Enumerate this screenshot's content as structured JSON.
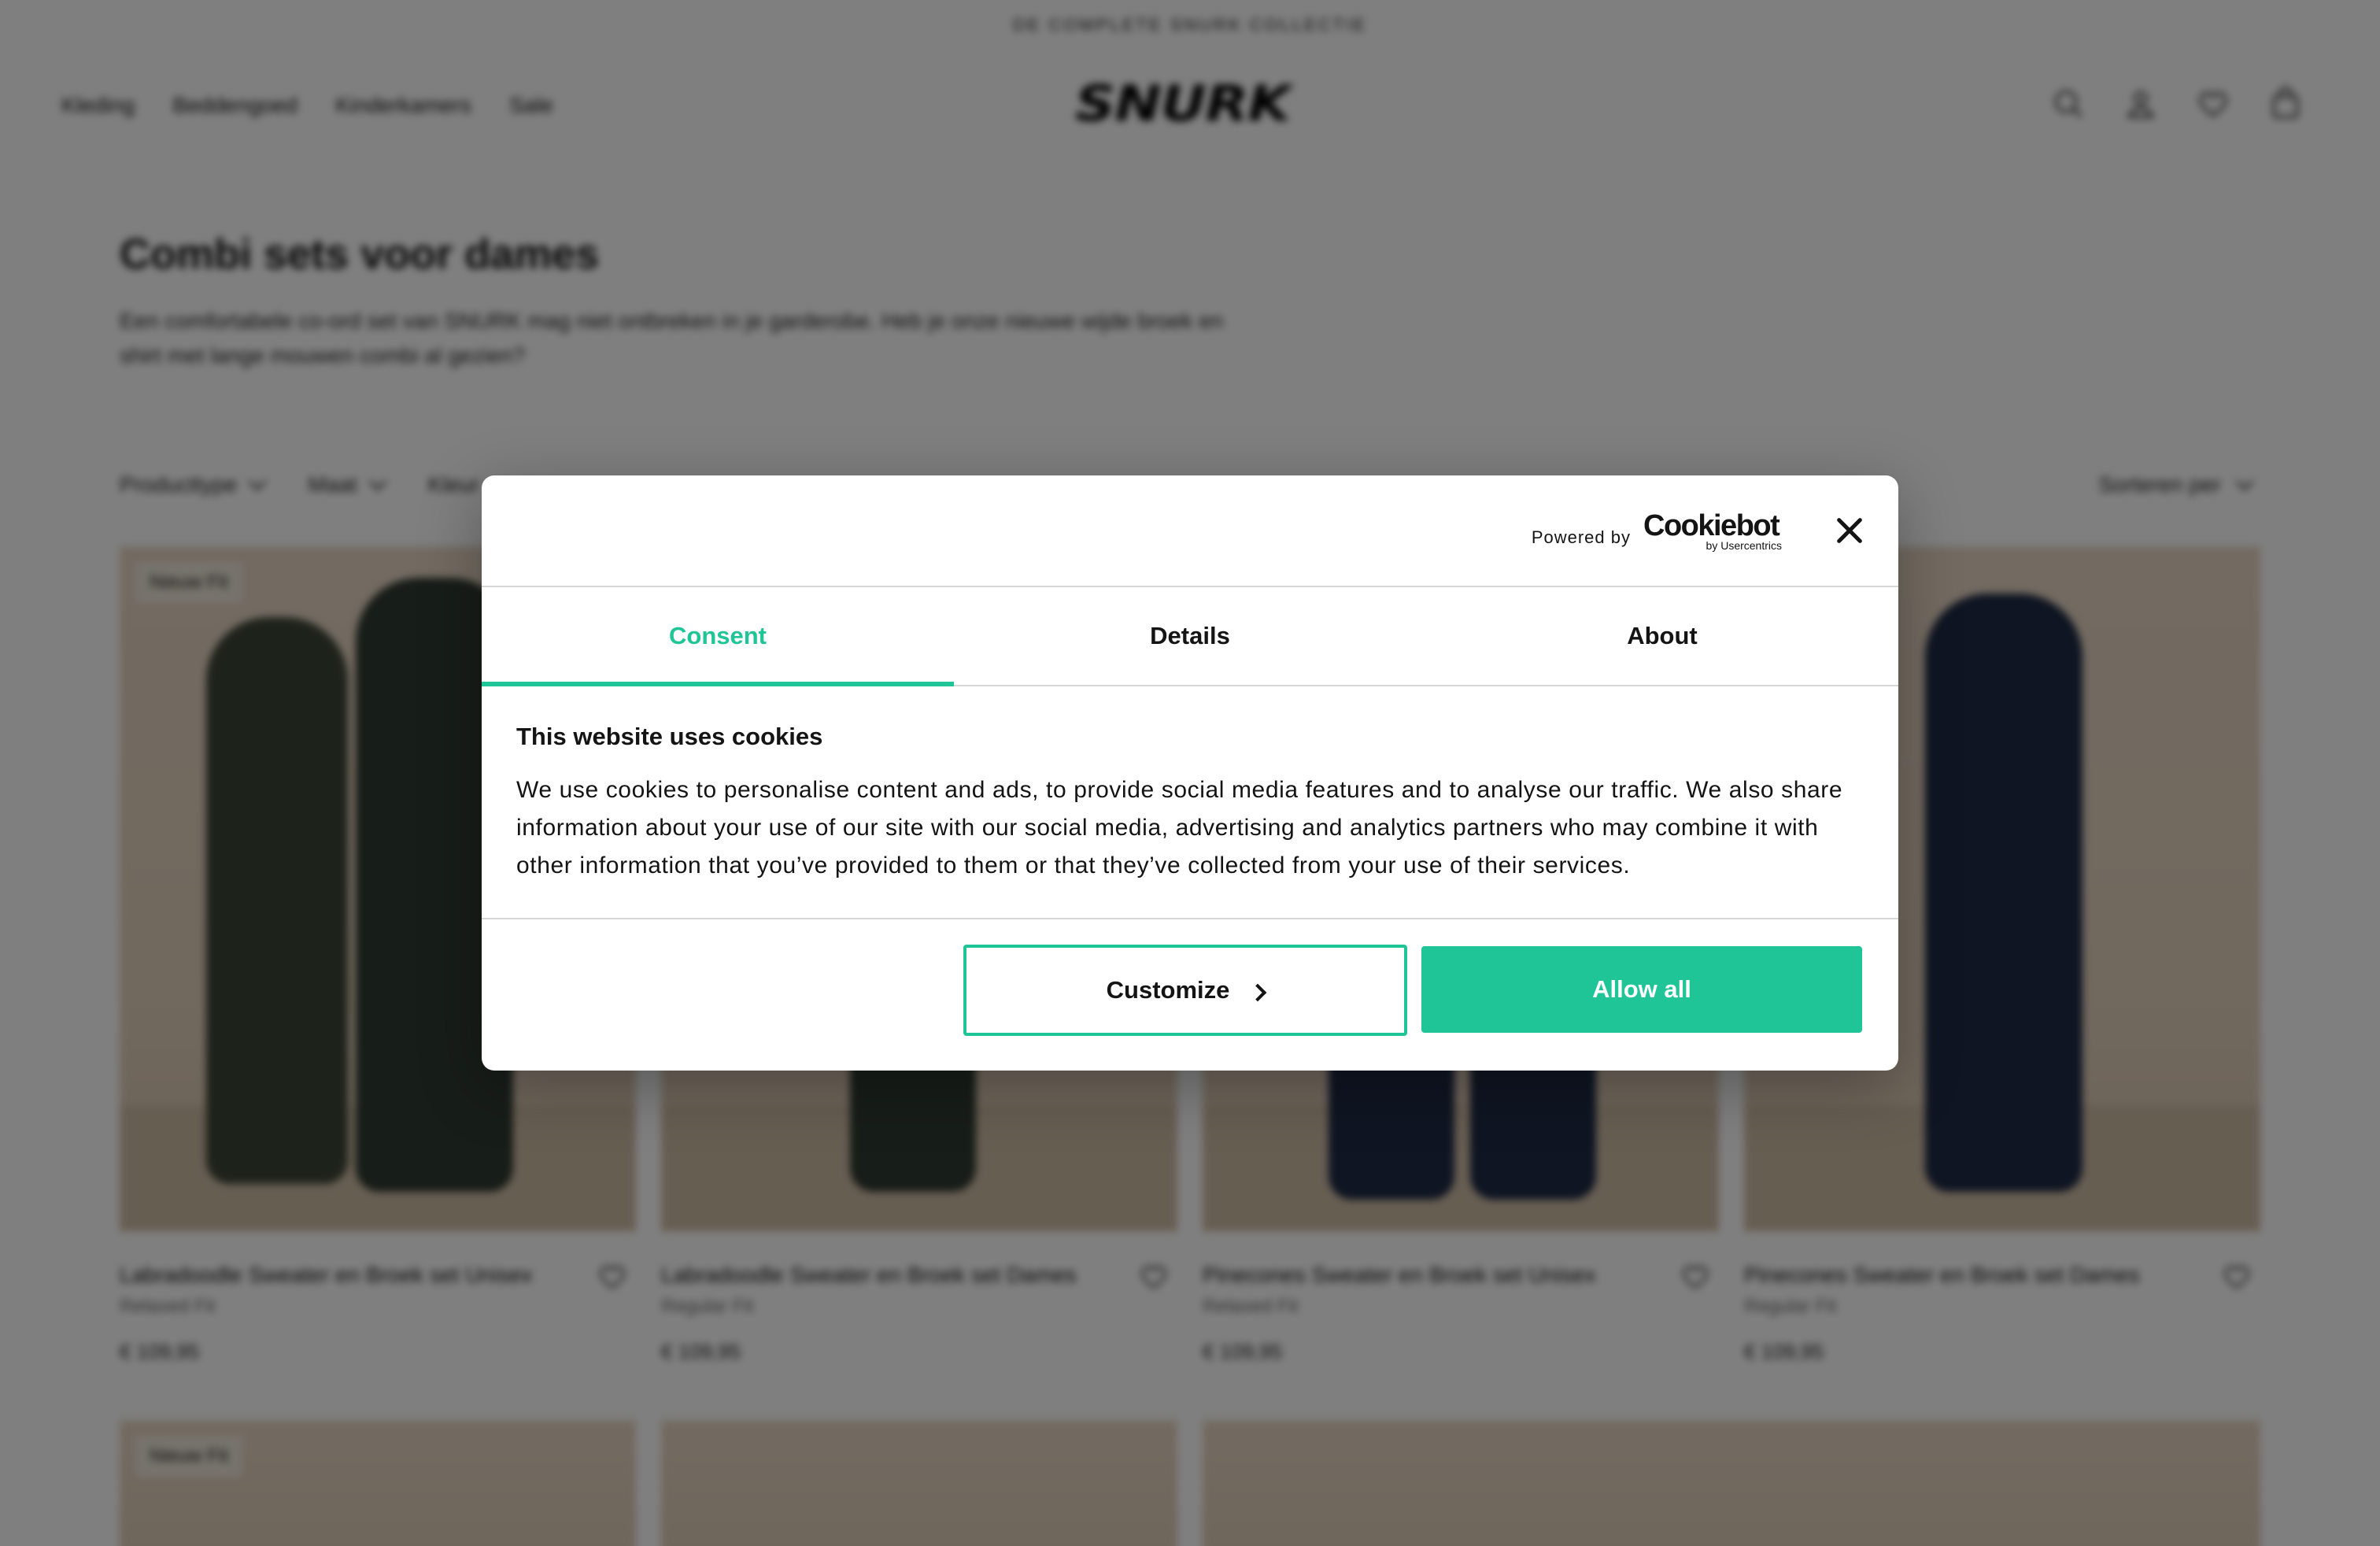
{
  "announcement": "DE COMPLETE SNURK COLLECTIE",
  "nav": {
    "items": [
      "Kleding",
      "Beddengoed",
      "Kinderkamers",
      "Sale"
    ]
  },
  "brand": {
    "logo_text": "SNURK"
  },
  "header_icons": [
    "search-icon",
    "account-icon",
    "wishlist-icon",
    "cart-icon"
  ],
  "category": {
    "title": "Combi sets voor dames",
    "description": "Een comfortabele co-ord set van SNURK mag niet ontbreken in je garderobe. Heb je onze nieuwe wijde broek en shirt met lange mouwen combi al gezien?"
  },
  "filters": {
    "items": [
      "Producttype",
      "Maat",
      "Kleur"
    ],
    "sort_label": "Sorteren per"
  },
  "products": [
    {
      "badge": "Nieuw Fit",
      "title": "Labradoodle Sweater en Broek set Unisex",
      "fit": "Relaxed Fit",
      "price": "€ 109,95"
    },
    {
      "badge": "",
      "title": "Labradoodle Sweater en Broek set Dames",
      "fit": "Regular Fit",
      "price": "€ 109,95"
    },
    {
      "badge": "",
      "title": "Pinecones Sweater en Broek set Unisex",
      "fit": "Relaxed Fit",
      "price": "€ 109,95"
    },
    {
      "badge": "",
      "title": "Pinecones Sweater en Broek set Dames",
      "fit": "Regular Fit",
      "price": "€ 109,95"
    }
  ],
  "row2_badge": "Nieuw Fit",
  "cookie_dialog": {
    "powered_by": "Powered by",
    "provider_name": "Cookiebot",
    "provider_sub": "by Usercentrics",
    "tabs": [
      {
        "label": "Consent",
        "active": true
      },
      {
        "label": "Details",
        "active": false
      },
      {
        "label": "About",
        "active": false
      }
    ],
    "title": "This website uses cookies",
    "text": "We use cookies to personalise content and ads, to provide social media features and to analyse our traffic. We also share information about your use of our site with our social media, advertising and analytics partners who may combine it with other information that you’ve provided to them or that they’ve collected from your use of their services.",
    "customize_label": "Customize",
    "allow_all_label": "Allow all",
    "accent_color": "#1fc497"
  }
}
